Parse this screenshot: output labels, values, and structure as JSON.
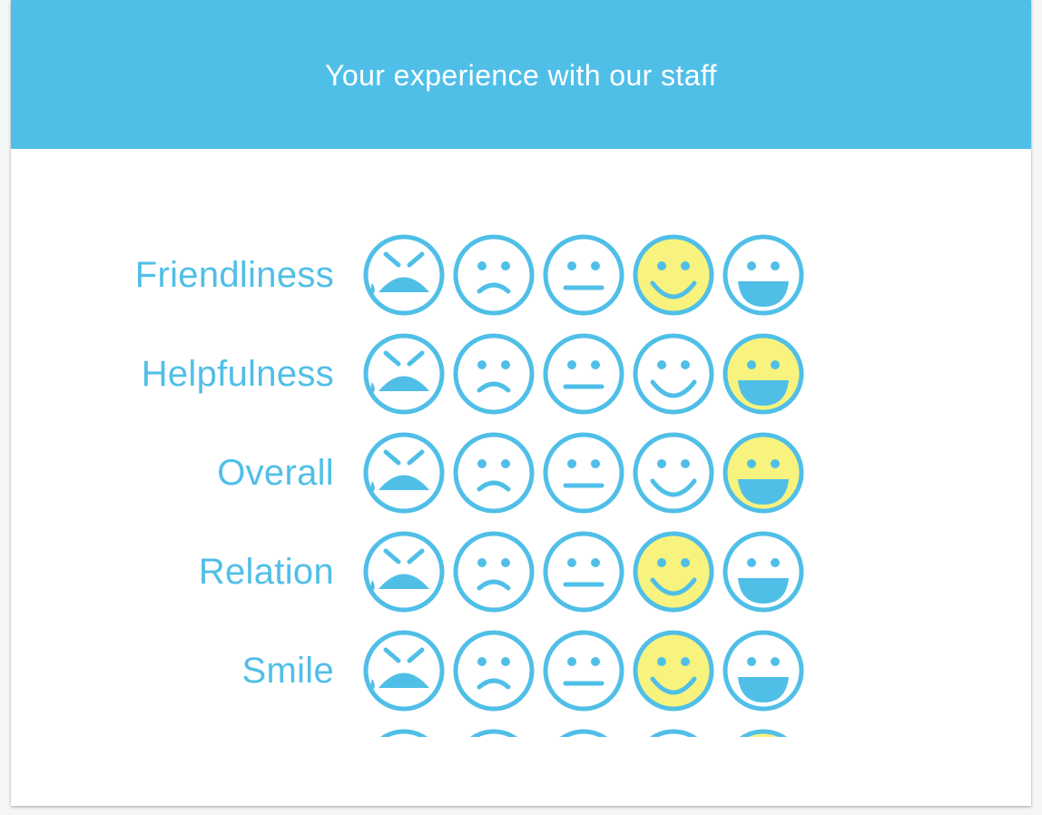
{
  "header": {
    "title": "Your experience with our staff"
  },
  "colors": {
    "accent": "#50bfe7",
    "selected_fill": "#f8f37e",
    "background": "#ffffff"
  },
  "scale": [
    {
      "value": 1,
      "icon": "crying-face-icon"
    },
    {
      "value": 2,
      "icon": "sad-face-icon"
    },
    {
      "value": 3,
      "icon": "neutral-face-icon"
    },
    {
      "value": 4,
      "icon": "smiling-face-icon"
    },
    {
      "value": 5,
      "icon": "grinning-face-icon"
    }
  ],
  "rows": [
    {
      "label": "Friendliness",
      "selected": 4
    },
    {
      "label": "Helpfulness",
      "selected": 5
    },
    {
      "label": "Overall",
      "selected": 5
    },
    {
      "label": "Relation",
      "selected": 4
    },
    {
      "label": "Smile",
      "selected": 4
    },
    {
      "label": "",
      "selected": 5
    }
  ]
}
